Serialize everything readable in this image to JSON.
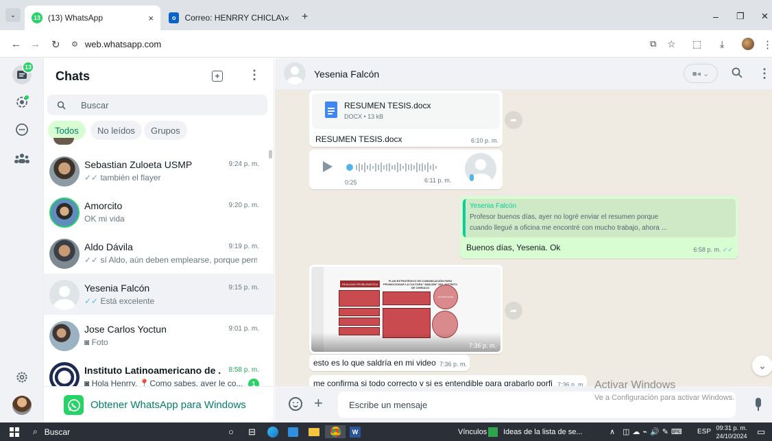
{
  "browser": {
    "tabs": [
      {
        "label": "(13) WhatsApp",
        "badge": "13",
        "close": "×"
      },
      {
        "label": "Correo: HENRRY CHICLAYO VEC",
        "close": "×"
      }
    ],
    "new_tab": "+",
    "url": "web.whatsapp.com",
    "win_min": "–",
    "win_restore": "❐",
    "win_close": "✕"
  },
  "rail": {
    "unread_badge": "13"
  },
  "sidebar": {
    "title": "Chats",
    "search_placeholder": "Buscar",
    "filters": [
      "Todos",
      "No leídos",
      "Grupos"
    ],
    "chats": [
      {
        "name": "Sebastian Zuloeta USMP",
        "time": "9:24 p. m.",
        "preview": "también el flayer",
        "ticks": "✓✓"
      },
      {
        "name": "Amorcito",
        "time": "9:20 p. m.",
        "preview": "OK mi vida"
      },
      {
        "name": "Aldo Dávila",
        "time": "9:19 p. m.",
        "preview": "sí Aldo, aún deben emplearse, porque perm...",
        "ticks": "✓✓"
      },
      {
        "name": "Yesenia Falcón",
        "time": "9:15 p. m.",
        "preview": "Está excelente",
        "ticks": "✓✓"
      },
      {
        "name": "Jose Carlos Yoctun",
        "time": "9:01 p. m.",
        "preview": "Foto"
      },
      {
        "name": "Instituto Latinoamericano de ...",
        "time": "8:58 p. m.",
        "preview": "Hola Henrry, 📍Como sabes, ayer le co...",
        "unread": "1"
      }
    ],
    "get_app": "Obtener WhatsApp para Windows"
  },
  "chat": {
    "contact": "Yesenia Falcón",
    "doc": {
      "name": "RESUMEN TESIS.docx",
      "meta": "DOCX • 13 kB",
      "caption": "RESUMEN TESIS.docx",
      "time": "6:10 p. m."
    },
    "voice": {
      "duration": "0:25",
      "time": "6:11 p. m."
    },
    "reply": {
      "quoted_name": "Yesenia Falcón",
      "quoted_line1": "Profesor buenos días, ayer no logré enviar el resumen  porque",
      "quoted_line2": "cuando llegué a oficina me encontré con mucho trabajo, ahora ...",
      "text": "Buenos días, Yesenia. Ok",
      "time": "6:58 p. m."
    },
    "image": {
      "time": "7:36 p. m.",
      "poster_title": "PLAN ESTRATÉGICO DE COMUNICACIÓN PARA PROMOCIONAR LA CULTURA \"AWAJÚN\" DEL DISTRITO DE CHIRIACO",
      "poster_left": "REALIDAD PROBLEMÁTICA",
      "poster_right": "JUSTIFICACIÓN"
    },
    "msg1": {
      "text": "esto es lo que saldría en mi video",
      "time": "7:36 p. m."
    },
    "msg2": {
      "text": "me confirma si todo correcto y si es entendible para grabarlo porfi",
      "time": "7:36 p. m."
    },
    "composer_placeholder": "Escribe un mensaje"
  },
  "watermark": {
    "title": "Activar Windows",
    "sub": "Ve a Configuración para activar Windows."
  },
  "taskbar": {
    "search": "Buscar",
    "links": "Vínculos",
    "browser_item": "Ideas de la lista de se...",
    "lang": "ESP",
    "time": "09:31 p. m.",
    "date": "24/10/2024"
  }
}
